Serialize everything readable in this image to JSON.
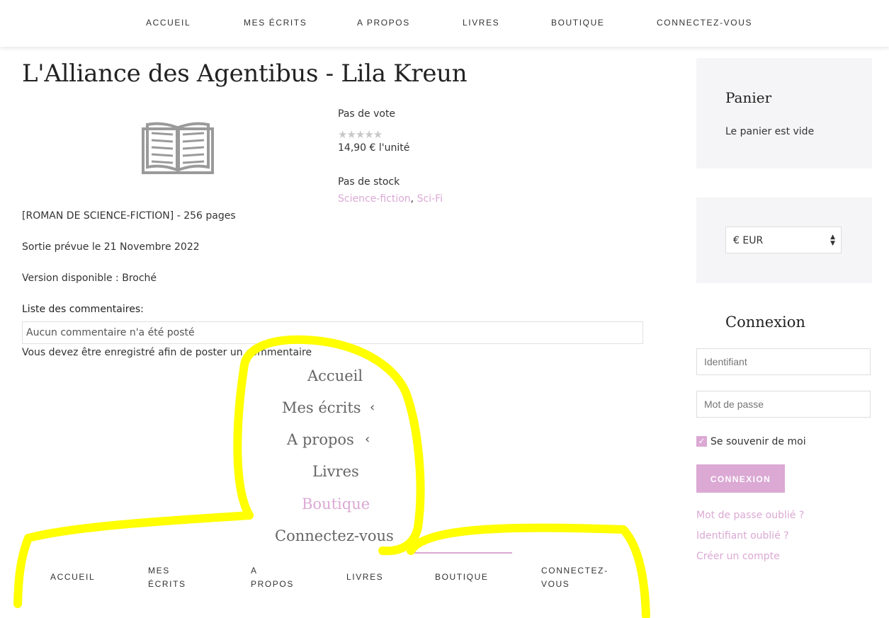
{
  "top_nav": [
    "ACCUEIL",
    "MES ÉCRITS",
    "A PROPOS",
    "LIVRES",
    "BOUTIQUE",
    "CONNECTEZ-VOUS"
  ],
  "product": {
    "title": "L'Alliance des Agentibus - Lila Kreun",
    "icon": "open-book-icon",
    "rating_text": "Pas de vote",
    "rating_stars": "★★★★★",
    "price": "14,90 € l'unité",
    "stock": "Pas de stock",
    "category_1": "Science-fiction",
    "category_separator": ",",
    "category_2": "Sci-Fi",
    "desc_1": "[ROMAN DE SCIENCE-FICTION] - 256 pages",
    "desc_2": "Sortie prévue le 21 Novembre 2022",
    "desc_3": "Version disponible  : Broché"
  },
  "comments": {
    "label": "Liste des commentaires:",
    "empty": "Aucun commentaire n'a été posté",
    "notice": "Vous devez être enregistré afin de poster un commentaire"
  },
  "mobile_menu": {
    "items": [
      "Accueil",
      "Mes écrits",
      "A propos",
      "Livres",
      "Boutique",
      "Connectez-vous"
    ],
    "chevron": "‹"
  },
  "bottom_nav": {
    "accueil": "ACCUEIL",
    "mes_1": "MES",
    "mes_2": "ÉCRITS",
    "apropos_1": "A",
    "apropos_2": "PROPOS",
    "livres": "LIVRES",
    "boutique": "BOUTIQUE",
    "connect_1": "CONNECTEZ-",
    "connect_2": "VOUS"
  },
  "cart": {
    "title": "Panier",
    "empty": "Le panier est vide"
  },
  "currency": {
    "selected": "€ EUR"
  },
  "login": {
    "title": "Connexion",
    "username_placeholder": "Identifiant",
    "password_placeholder": "Mot de passe",
    "remember": "Se souvenir de moi",
    "checkmark": "✓",
    "button": "CONNEXION",
    "forgot_password": "Mot de passe oublié ?",
    "forgot_username": "Identifiant oublié ?",
    "create_account": "Créer un compte"
  },
  "colors": {
    "accent_pink": "#dba9d4",
    "highlight_yellow": "#ffff00",
    "widget_bg": "#f5f5f7"
  }
}
